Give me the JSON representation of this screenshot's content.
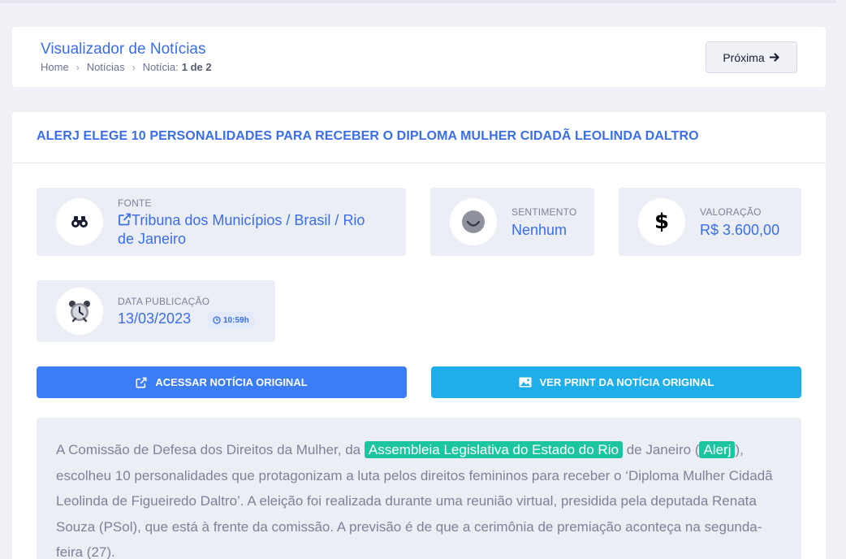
{
  "header": {
    "title": "Visualizador de Notícias",
    "breadcrumb": [
      "Home",
      "Notícias",
      "Notícia:"
    ],
    "breadcrumb_position": "1 de 2",
    "next_label": "Próxima"
  },
  "news": {
    "title": "ALERJ ELEGE 10 PERSONALIDADES PARA RECEBER O DIPLOMA MULHER CIDADÃ LEOLINDA DALTRO",
    "fonte_label": "FONTE",
    "fonte_value_line1": "Tribuna dos Municípios / Brasil / Rio",
    "fonte_value_line2": "de Janeiro",
    "sentimento_label": "SENTIMENTO",
    "sentimento_value": "Nenhum",
    "valoracao_label": "VALORAÇÃO",
    "valoracao_value": "R$ 3.600,00",
    "data_label": "DATA PUBLICAÇÃO",
    "data_value": "13/03/2023",
    "time_value": "10:59h"
  },
  "actions": {
    "access_label": "ACESSAR NOTÍCIA ORIGINAL",
    "print_label": "VER PRINT DA NOTÍCIA ORIGINAL"
  },
  "body": {
    "p1": "A Comissão de Defesa dos Direitos da Mulher, da",
    "hl1": "Assembleia Legislativa do Estado do Rio",
    "p2": "de Janeiro (",
    "hl2": "Alerj",
    "p3": "), escolheu 10 personalidades que protagonizam a luta pelos direitos femininos para receber o ‘Diploma Mulher Cidadã Leolinda de Figueiredo Daltro’. A eleição foi realizada durante uma reunião virtual, presidida pela deputada Renata Souza (PSol), que está à frente da comissão. A previsão é de que a cerimônia de premiação aconteça na segunda-feira (27)."
  },
  "colors": {
    "primary": "#3b7cf7",
    "info": "#1eaee9",
    "highlight": "#1bc5a0",
    "title_blue": "#3a6ee8"
  },
  "icons": [
    "binoculars-icon",
    "external-link-icon",
    "neutral-face-icon",
    "dollar-icon",
    "alarm-clock-icon",
    "clock-icon",
    "arrow-right-icon",
    "image-icon"
  ]
}
